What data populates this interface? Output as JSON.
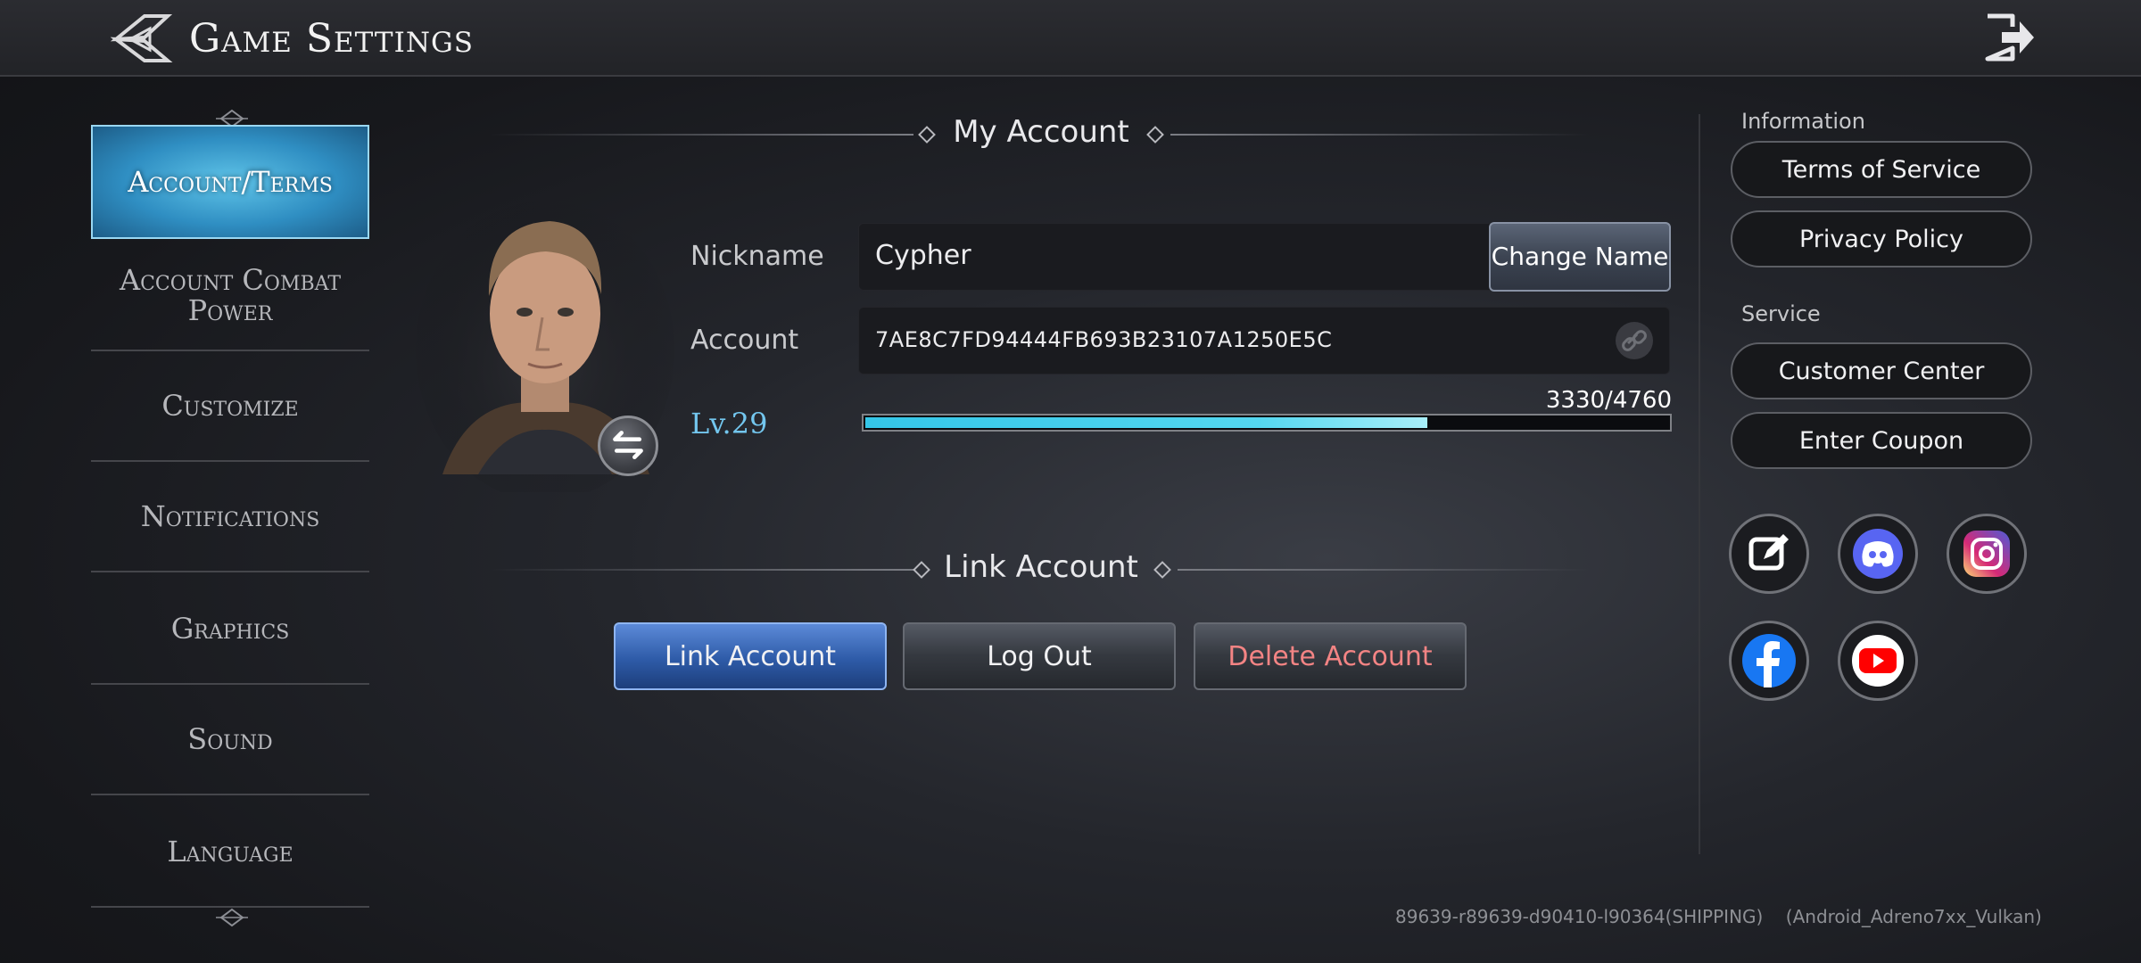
{
  "header": {
    "title": "Game Settings"
  },
  "sidebar": {
    "items": [
      {
        "label": "Account/Terms",
        "active": true
      },
      {
        "label": "Account Combat Power"
      },
      {
        "label": "Customize"
      },
      {
        "label": "Notifications"
      },
      {
        "label": "Graphics"
      },
      {
        "label": "Sound"
      },
      {
        "label": "Language"
      }
    ]
  },
  "my_account": {
    "title": "My Account",
    "nickname_label": "Nickname",
    "nickname_value": "Cypher",
    "change_name_label": "Change Name",
    "account_label": "Account",
    "account_value": "7AE8C7FD94444FB693B23107A1250E5C",
    "level": "Lv.29",
    "xp_text": "3330/4760",
    "xp_fraction": 0.6996
  },
  "link_account": {
    "title": "Link Account",
    "buttons": {
      "link": "Link Account",
      "logout": "Log Out",
      "delete": "Delete Account"
    }
  },
  "right_panel": {
    "information_label": "Information",
    "terms_label": "Terms of Service",
    "privacy_label": "Privacy Policy",
    "service_label": "Service",
    "customer_center_label": "Customer Center",
    "coupon_label": "Enter Coupon",
    "socials": [
      "community-icon",
      "discord-icon",
      "instagram-icon",
      "facebook-icon",
      "youtube-icon"
    ]
  },
  "footer": {
    "version": "89639-r89639-d90410-l90364(SHIPPING)",
    "platform": "(Android_Adreno7xx_Vulkan)"
  },
  "colors": {
    "accent_blue": "#34c6e8",
    "danger": "#f38484",
    "level_text": "#73c6ee"
  }
}
